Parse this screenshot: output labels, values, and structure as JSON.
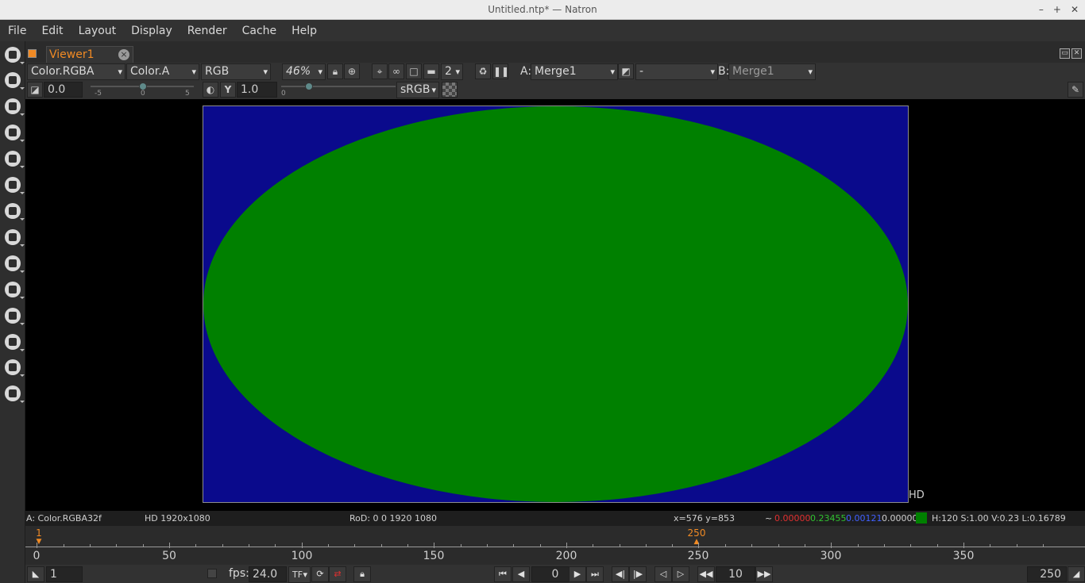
{
  "window": {
    "title": "Untitled.ntp* — Natron",
    "controls": [
      "–",
      "+",
      "✕"
    ]
  },
  "menu": [
    "File",
    "Edit",
    "Layout",
    "Display",
    "Render",
    "Cache",
    "Help"
  ],
  "tab": {
    "label": "Viewer1"
  },
  "viewer_toolbar": {
    "layer": "Color.RGBA",
    "alpha_channel": "Color.A",
    "display_channels": "RGB",
    "zoom": "46%",
    "proxy_level": "2",
    "a_label": "A:",
    "a_input": "Merge1",
    "composite_op": "-",
    "b_label": "B:",
    "b_input": "Merge1",
    "gain": "0.0",
    "gain_ticks": [
      "-5",
      "0",
      "5"
    ],
    "gamma": "1.0",
    "gamma_tick": "0",
    "colorspace": "sRGB"
  },
  "viewer": {
    "format_label": "HD"
  },
  "info_bar": {
    "input": "A: Color.RGBA32f",
    "format": "HD 1920x1080",
    "rod": "RoD: 0 0 1920 1080",
    "coords": "x=576 y=853",
    "tilde": "~",
    "r": "0.00000",
    "g": "0.23455",
    "b": "0.00121",
    "a": "0.00000",
    "swatch_color": "#008000",
    "hsvl": "H:120 S:1.00 V:0.23 L:0.16789"
  },
  "timeline": {
    "ticks": [
      "0",
      "50",
      "100",
      "150",
      "200",
      "250",
      "300",
      "350"
    ],
    "in_marker": "1",
    "out_marker": "250"
  },
  "playback": {
    "first_frame": "1",
    "fps_label": "fps:",
    "fps": "24.0",
    "turbo": "TF",
    "current_frame": "0",
    "increment": "10",
    "last_frame": "250"
  },
  "colors": {
    "accent": "#f08a24",
    "background": "#0a0a8c",
    "shape": "#008000"
  }
}
